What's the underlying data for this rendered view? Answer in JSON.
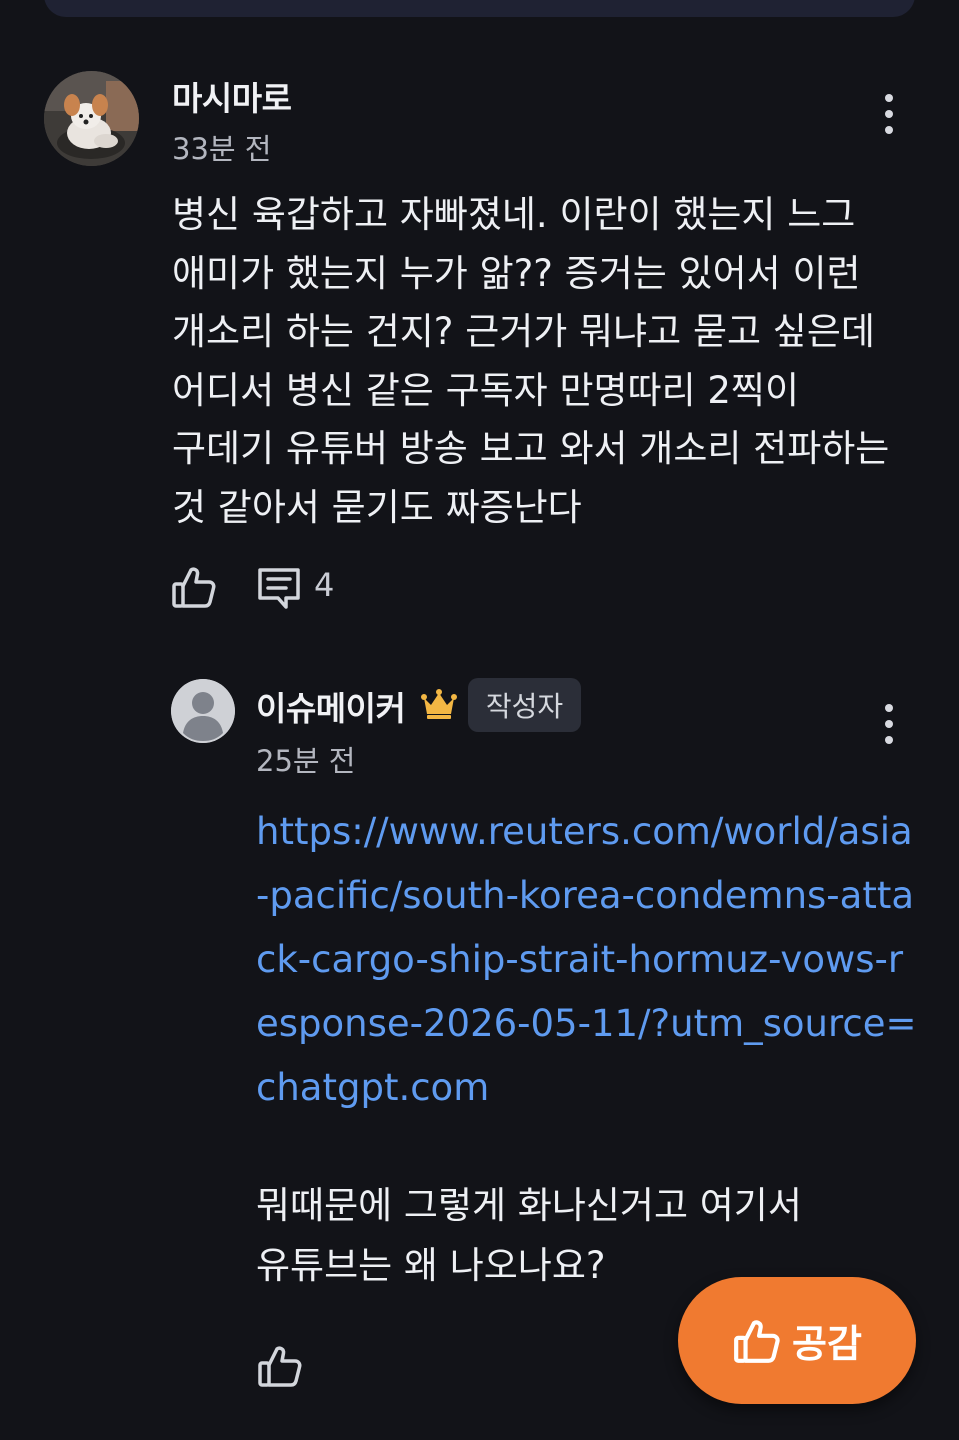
{
  "comment": {
    "author": "마시마로",
    "time": "33분 전",
    "body": "병신 육갑하고 자빠졌네. 이란이 했는지 느그 애미가 했는지 누가 앎?? 증거는 있어서 이런 개소리 하는 건지? 근거가 뭐냐고 묻고 싶은데 어디서 병신 같은 구독자 만명따리 2찍이 구데기 유튜버 방송 보고 와서 개소리 전파하는 것 같아서 묻기도 짜증난다",
    "reply_count": "4"
  },
  "reply": {
    "author": "이슈메이커",
    "badge": "작성자",
    "time": "25분 전",
    "link": "https://www.reuters.com/world/asia-pacific/south-korea-condemns-attack-cargo-ship-strait-hormuz-vows-response-2026-05-11/?utm_source=chatgpt.com",
    "body": "뭐때문에 그렇게 화나신거고 여기서 유튜브는 왜 나오나요?"
  },
  "fab": {
    "label": "공감"
  },
  "colors": {
    "background": "#121318",
    "link": "#5f9bf0",
    "accent": "#f07a30",
    "crown": "#f3b744"
  },
  "icons": {
    "like": "thumbs-up-icon",
    "reply": "reply-icon",
    "more": "more-vertical-icon",
    "crown": "crown-icon",
    "avatar_default": "person-icon"
  }
}
